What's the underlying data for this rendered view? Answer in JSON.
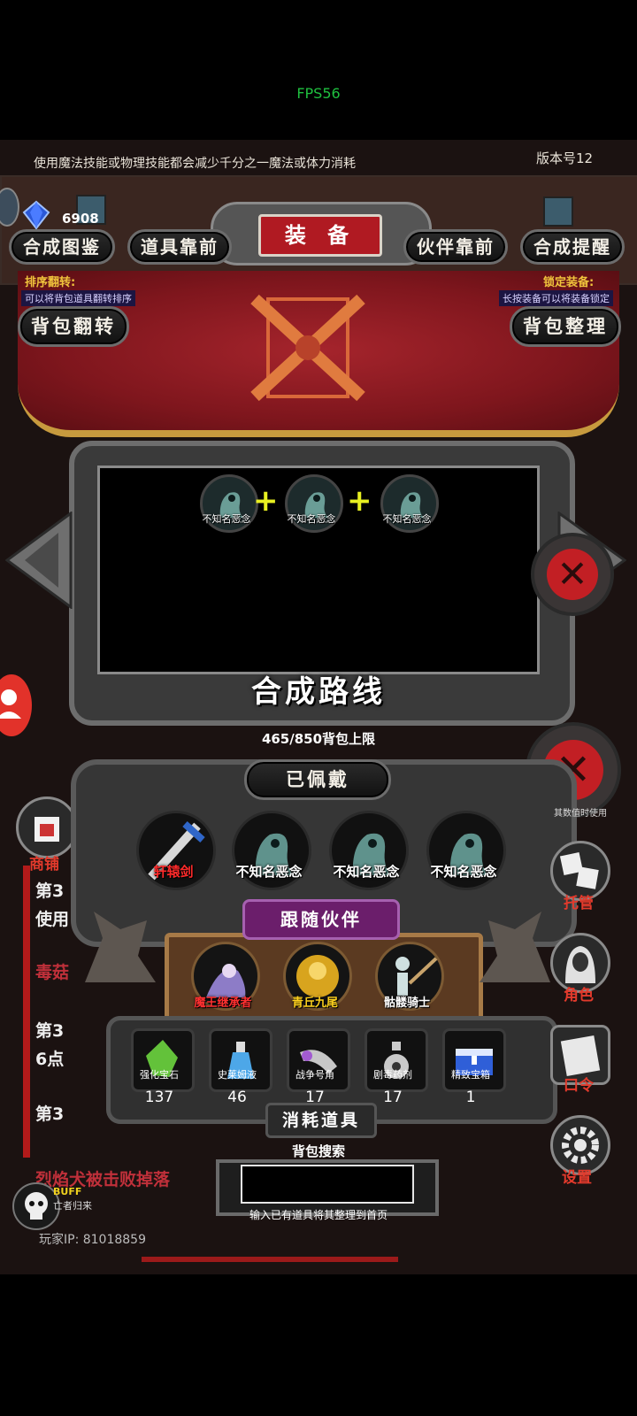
{
  "fps": "FPS56",
  "tip": "使用魔法技能或物理技能都会减少千分之一魔法或体力消耗",
  "version": "版本号12",
  "gems": "6908",
  "panel_title": "装 备",
  "top_buttons": [
    "合成图鉴",
    "道具靠前",
    "伙伴靠前",
    "合成提醒"
  ],
  "sort_flip": {
    "title": "排序翻转:",
    "desc": "可以将背包道具翻转排序"
  },
  "lock_equip": {
    "title": "锁定装备:",
    "desc": "长按装备可以将装备锁定"
  },
  "bag_flip_button": "背包翻转",
  "bag_sort_button": "背包整理",
  "craft": {
    "slots": [
      "不知名恶念",
      "不知名恶念",
      "不知名恶念"
    ],
    "route_title": "合成路线"
  },
  "bag_limit": "465/850背包上限",
  "equipped_title": "已佩戴",
  "equipped": [
    {
      "name": "轩辕剑",
      "color": "#ff2a2a"
    },
    {
      "name": "不知名恶念",
      "color": "#ffffff"
    },
    {
      "name": "不知名恶念",
      "color": "#ffffff"
    },
    {
      "name": "不知名恶念",
      "color": "#ffffff"
    }
  ],
  "partner_title": "跟随伙伴",
  "partners": [
    {
      "name": "魔王继承者",
      "color": "#ff3030"
    },
    {
      "name": "青丘九尾",
      "color": "#ffd21e"
    },
    {
      "name": "骷髅骑士",
      "color": "#ffffff"
    }
  ],
  "consumables": [
    {
      "name": "强化宝石",
      "count": "137"
    },
    {
      "name": "史莱姆液",
      "count": "46"
    },
    {
      "name": "战争号角",
      "count": "17"
    },
    {
      "name": "剧毒药剂",
      "count": "17"
    },
    {
      "name": "精致宝箱",
      "count": "1"
    }
  ],
  "consumables_title": "消耗道具",
  "search": {
    "title": "背包搜索",
    "hint": "输入已有道具将其整理到首页"
  },
  "left_shop": "商铺",
  "right_menu": [
    "托管",
    "角色",
    "口令",
    "设置"
  ],
  "log_lines": [
    "第3",
    "使用",
    "毒菇",
    "第3",
    "6点",
    "第3",
    "烈焰犬被击败掉落"
  ],
  "buff": {
    "label": "BUFF",
    "sub": "亡者归来"
  },
  "player_ip": "玩家IP:  81018859",
  "right_pct": "其数值时使用"
}
